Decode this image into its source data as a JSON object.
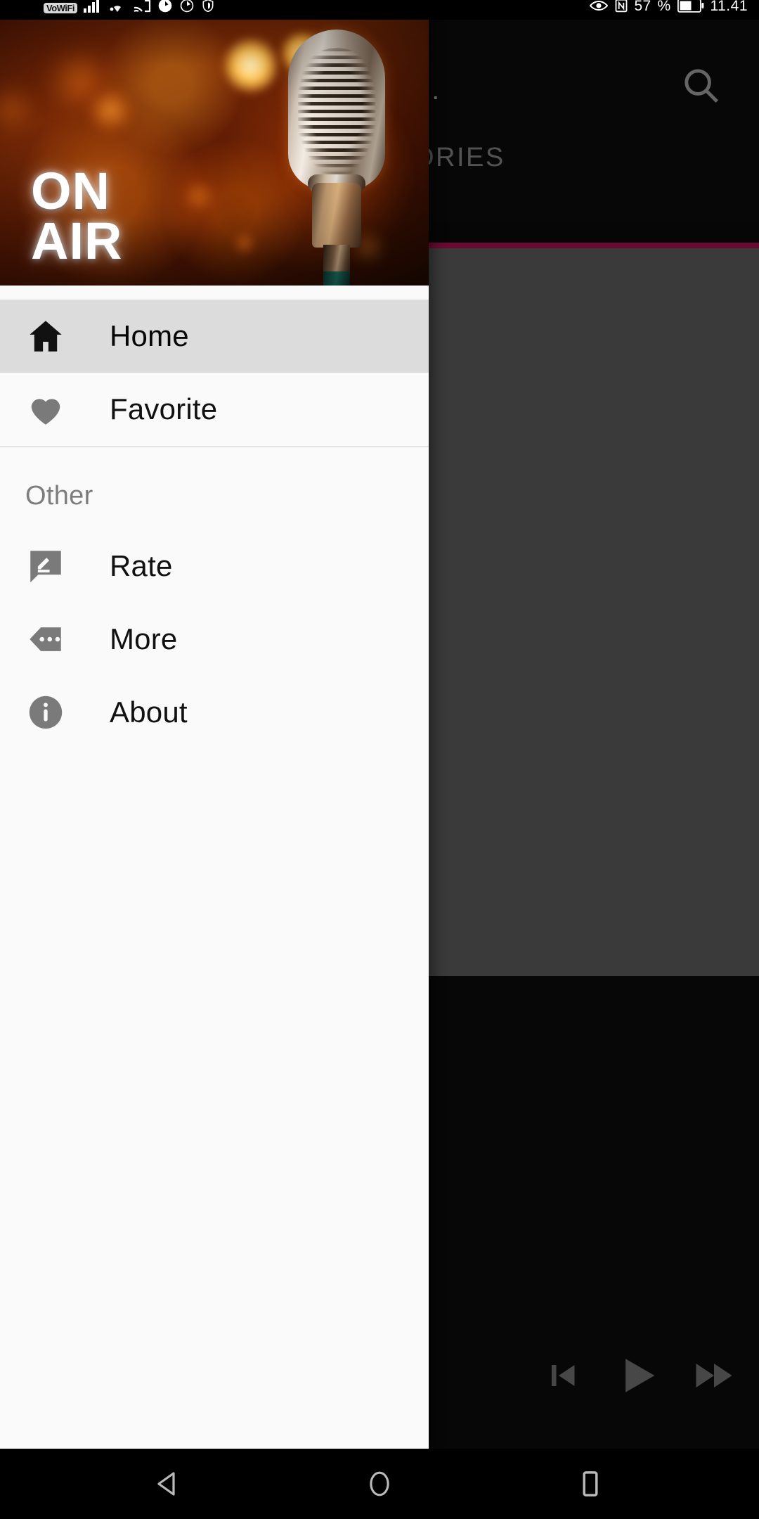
{
  "status_bar": {
    "vowifi_badge": "VoWiFi",
    "icons_left": [
      "vowifi-badge",
      "signal-bars-icon",
      "wifi-icon",
      "cast-icon",
      "sync-icon",
      "sync-alt-icon",
      "shield-icon"
    ],
    "icons_right": [
      "eye-icon",
      "nfc-icon",
      "battery-icon"
    ],
    "battery_percent": "57",
    "percent_symbol": "%",
    "time": "11.41"
  },
  "drawer": {
    "header": {
      "title_line1": "ON",
      "title_line2": "AIR",
      "image_alt": "vintage-microphone-stage-lights"
    },
    "main_items": [
      {
        "label": "Home",
        "icon": "home-icon",
        "selected": true
      },
      {
        "label": "Favorite",
        "icon": "heart-icon",
        "selected": false
      }
    ],
    "section_label": "Other",
    "other_items": [
      {
        "label": "Rate",
        "icon": "rate-review-icon"
      },
      {
        "label": "More",
        "icon": "more-tag-icon"
      },
      {
        "label": "About",
        "icon": "info-icon"
      }
    ]
  },
  "background_app": {
    "overflow_label": "..",
    "search_icon": "search-icon",
    "tab_label": "ORIES",
    "tab_indicator_color": "#a3104a",
    "player": {
      "previous_icon": "skip-previous-icon",
      "play_icon": "play-icon",
      "forward_icon": "fast-forward-icon"
    }
  },
  "nav_bar": {
    "back": "back-triangle-icon",
    "home": "home-circle-icon",
    "recents": "recents-square-icon"
  },
  "colors": {
    "drawer_bg": "#fafafa",
    "selected_item_bg": "#dcdcdc",
    "accent_pink": "#a3104a",
    "icon_grey": "#7a7a7a"
  }
}
